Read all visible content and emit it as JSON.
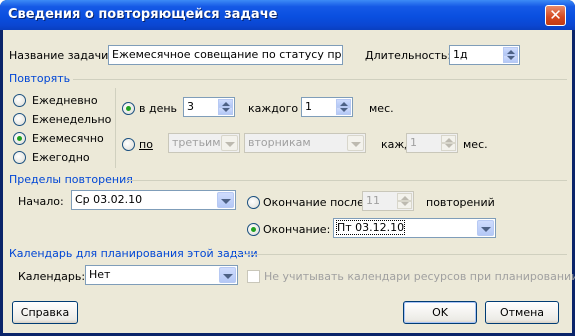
{
  "window": {
    "title": "Сведения о повторяющейся задаче",
    "close_glyph": "✕"
  },
  "task": {
    "name_label": "Название задачи:",
    "name_value": "Ежемесячное совещание по статусу проекта",
    "duration_label": "Длительность:",
    "duration_value": "1д"
  },
  "repeat": {
    "section_label": "Повторять",
    "options": [
      "Ежедневно",
      "Еженедельно",
      "Ежемесячно",
      "Ежегодно"
    ],
    "selected": "Ежемесячно",
    "by_day": {
      "label": "в день",
      "day_value": "3",
      "every_label": "каждого",
      "every_value": "1",
      "unit": "мес."
    },
    "by_weekday": {
      "label": "по",
      "ordinal_value": "третьим",
      "weekday_value": "вторникам",
      "every_label": "каждого",
      "every_value": "1",
      "unit": "мес."
    }
  },
  "range": {
    "section_label": "Пределы повторения",
    "start_label": "Начало:",
    "start_value": "Ср 03.02.10",
    "end_after_label": "Окончание после",
    "end_after_value": "11",
    "occurrences_label": "повторений",
    "end_by_label": "Окончание:",
    "end_by_value": "Пт 03.12.10"
  },
  "calendar": {
    "section_label": "Календарь для планирования этой задачи",
    "label": "Календарь:",
    "value": "Нет",
    "ignore_label": "Не учитывать календари ресурсов при планировании"
  },
  "buttons": {
    "help": "Справка",
    "ok": "OK",
    "cancel": "Отмена"
  }
}
